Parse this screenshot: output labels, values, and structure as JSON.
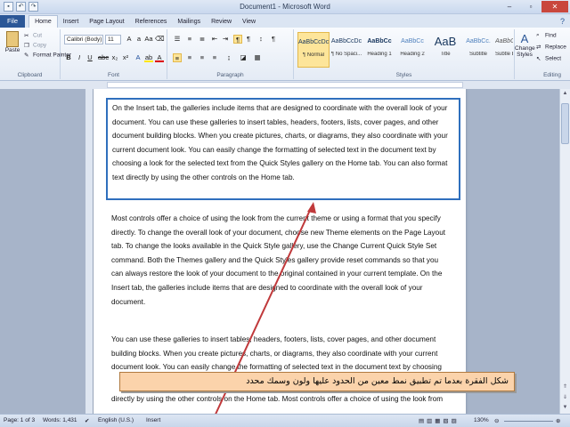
{
  "window": {
    "title": "Document1 - Microsoft Word"
  },
  "qat": {
    "save_icon": "save-icon",
    "undo_icon": "undo-icon",
    "redo_icon": "redo-icon"
  },
  "tabs": [
    "Home",
    "Insert",
    "Page Layout",
    "References",
    "Mailings",
    "Review",
    "View"
  ],
  "file_tab": "File",
  "clipboard": {
    "paste": "Paste",
    "cut": "Cut",
    "copy": "Copy",
    "format_painter": "Format Painter",
    "label": "Clipboard"
  },
  "font": {
    "family": "Calibri (Body)",
    "size": "11",
    "label": "Font"
  },
  "paragraph": {
    "label": "Paragraph"
  },
  "styles": {
    "label": "Styles",
    "items": [
      {
        "preview": "AaBbCcDc",
        "name": "¶ Normal"
      },
      {
        "preview": "AaBbCcDc",
        "name": "¶ No Spaci..."
      },
      {
        "preview": "AaBbCc",
        "name": "Heading 1"
      },
      {
        "preview": "AaBbCc",
        "name": "Heading 2"
      },
      {
        "preview": "AaB",
        "name": "Title"
      },
      {
        "preview": "AaBbCc.",
        "name": "Subtitle"
      },
      {
        "preview": "AaBbCcDc",
        "name": "Subtle Em..."
      }
    ],
    "change_styles": "Change Styles"
  },
  "editing": {
    "find": "Find",
    "replace": "Replace",
    "select": "Select",
    "label": "Editing"
  },
  "document": {
    "p1": "On the Insert tab, the galleries include items that are designed to coordinate with the overall look of your document. You can use these galleries to insert tables, headers, footers, lists, cover pages, and other document building blocks. When you create pictures, charts, or diagrams, they also coordinate with your current document look. You can easily change the formatting of selected text in the document text by choosing a look for the selected text from the Quick Styles gallery on the Home tab. You can also format text directly by using the other controls on the Home tab.",
    "p2": "Most controls offer a choice of using the look from the current theme or using a format that you specify directly. To change the overall look of your document, choose new Theme elements on the Page Layout tab. To change the looks available in the Quick Style gallery, use the Change Current Quick Style Set command. Both the Themes gallery and the Quick Styles gallery provide reset commands so that you can always restore the look of your document to the original contained in your current template. On the Insert tab, the galleries include items that are designed to coordinate with the overall look of your document.",
    "p3": "You can use these galleries to insert tables, headers, footers, lists, cover pages, and other document building blocks. When you create pictures, charts, or diagrams, they also coordinate with your current document look. You can easily change the formatting of selected text in the document text by choosing",
    "p4": "directly by using the other controls on the Home tab. Most controls offer a choice of using the look from"
  },
  "caption": "شكل الفقرة بعدما تم تطبيق نمط معين من الحدود عليها ولون وسمك محدد",
  "status": {
    "page": "Page: 1 of 3",
    "words": "Words: 1,431",
    "language": "English (U.S.)",
    "mode": "Insert",
    "zoom": "130%"
  },
  "colors": {
    "accent": "#2b5797",
    "border": "#2f6fbd",
    "caption_bg": "#fbd3ab",
    "arrow": "#c0393b"
  }
}
